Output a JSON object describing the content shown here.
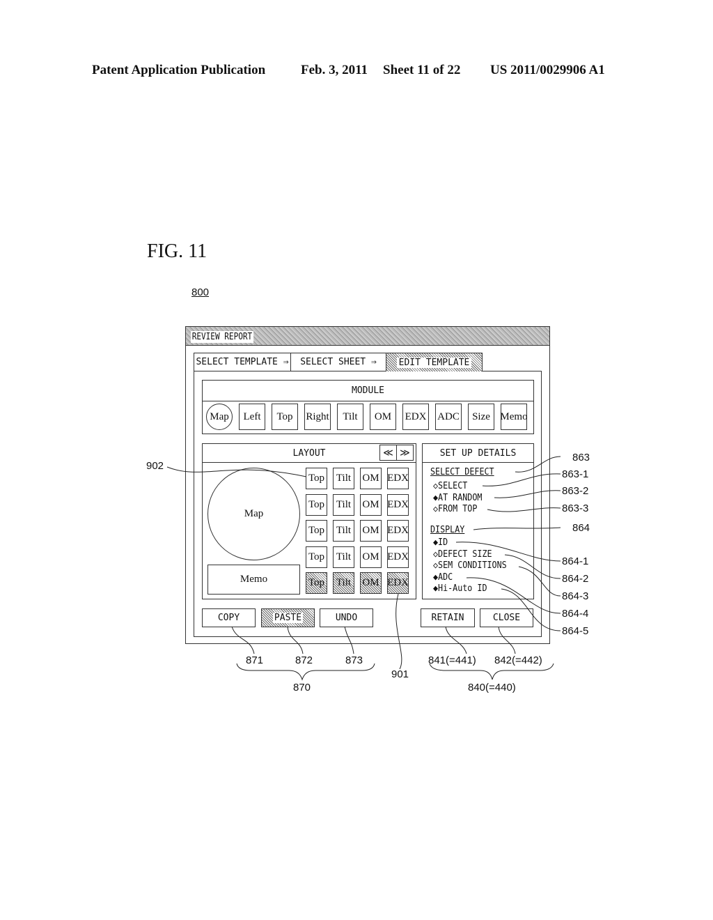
{
  "header": {
    "publication": "Patent Application Publication",
    "date": "Feb. 3, 2011",
    "sheet": "Sheet 11 of 22",
    "number": "US 2011/0029906 A1"
  },
  "figure": {
    "title": "FIG. 11",
    "ref": "800"
  },
  "window": {
    "title": "REVIEW REPORT",
    "tabs": [
      {
        "label": "SELECT TEMPLATE ⇒",
        "active": false
      },
      {
        "label": "SELECT SHEET ⇒",
        "active": false
      },
      {
        "label": "EDIT TEMPLATE",
        "active": true
      }
    ],
    "module": {
      "heading": "MODULE",
      "items": [
        "Map",
        "Left",
        "Top",
        "Right",
        "Tilt",
        "OM",
        "EDX",
        "ADC",
        "Size",
        "Memo"
      ]
    },
    "layout": {
      "heading": "LAYOUT",
      "prev_label": "≪",
      "next_label": "≫",
      "map_label": "Map",
      "memo_label": "Memo",
      "rows": [
        {
          "cells": [
            "Top",
            "Tilt",
            "OM",
            "EDX"
          ],
          "selected": false
        },
        {
          "cells": [
            "Top",
            "Tilt",
            "OM",
            "EDX"
          ],
          "selected": false
        },
        {
          "cells": [
            "Top",
            "Tilt",
            "OM",
            "EDX"
          ],
          "selected": false
        },
        {
          "cells": [
            "Top",
            "Tilt",
            "OM",
            "EDX"
          ],
          "selected": false
        },
        {
          "cells": [
            "Top",
            "Tilt",
            "OM",
            "EDX"
          ],
          "selected": true
        }
      ]
    },
    "details": {
      "heading": "SET UP DETAILS",
      "select_defect": {
        "label": "SELECT DEFECT",
        "options": [
          {
            "symbol": "◇",
            "label": "SELECT",
            "selected": false
          },
          {
            "symbol": "◆",
            "label": "AT RANDOM",
            "selected": true
          },
          {
            "symbol": "◇",
            "label": "FROM TOP",
            "selected": false
          }
        ]
      },
      "display": {
        "label": "DISPLAY",
        "options": [
          {
            "symbol": "◆",
            "label": "ID",
            "selected": true
          },
          {
            "symbol": "◇",
            "label": "DEFECT SIZE",
            "selected": false
          },
          {
            "symbol": "◇",
            "label": "SEM CONDITIONS",
            "selected": false
          },
          {
            "symbol": "◆",
            "label": "ADC",
            "selected": true
          },
          {
            "symbol": "◆",
            "label": "Hi-Auto ID",
            "selected": true
          }
        ]
      }
    },
    "buttons": {
      "copy": "COPY",
      "paste": "PASTE",
      "undo": "UNDO",
      "retain": "RETAIN",
      "close": "CLOSE"
    }
  },
  "ref_labels": {
    "r902": "902",
    "r901": "901",
    "r863": "863",
    "r863_1": "863-1",
    "r863_2": "863-2",
    "r863_3": "863-3",
    "r864": "864",
    "r864_1": "864-1",
    "r864_2": "864-2",
    "r864_3": "864-3",
    "r864_4": "864-4",
    "r864_5": "864-5",
    "r871": "871",
    "r872": "872",
    "r873": "873",
    "r870": "870",
    "r841": "841(=441)",
    "r842": "842(=442)",
    "r840": "840(=440)"
  }
}
